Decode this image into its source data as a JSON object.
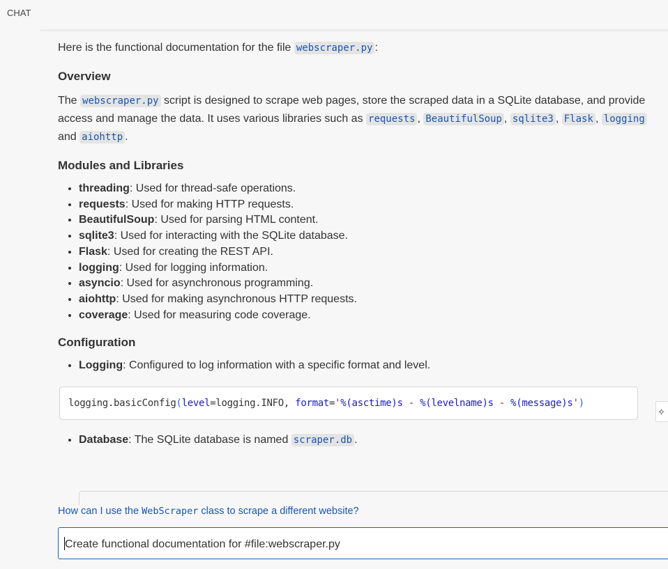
{
  "header": {
    "title": "CHAT"
  },
  "message": {
    "intro": {
      "text": "Here is the functional documentation for the file ",
      "code": "webscraper.py",
      "end": ":"
    },
    "overview": {
      "heading": "Overview",
      "l1a": "The ",
      "l1code": "webscraper.py",
      "l1b": " script is designed to scrape web pages, store the scraped data in a SQLite database, and provide",
      "l2a": "access and manage the data. It uses various libraries such as ",
      "c1": "requests",
      "c2": "BeautifulSoup",
      "c3": "sqlite3",
      "c4": "Flask",
      "c5": "logging",
      "sep": ", ",
      "l3a": "and ",
      "c6": "aiohttp",
      "l3b": "."
    },
    "modules": {
      "heading": "Modules and Libraries",
      "items": [
        {
          "name": "threading",
          "desc": ": Used for thread-safe operations."
        },
        {
          "name": "requests",
          "desc": ": Used for making HTTP requests."
        },
        {
          "name": "BeautifulSoup",
          "desc": ": Used for parsing HTML content."
        },
        {
          "name": "sqlite3",
          "desc": ": Used for interacting with the SQLite database."
        },
        {
          "name": "Flask",
          "desc": ": Used for creating the REST API."
        },
        {
          "name": "logging",
          "desc": ": Used for logging information."
        },
        {
          "name": "asyncio",
          "desc": ": Used for asynchronous programming."
        },
        {
          "name": "aiohttp",
          "desc": ": Used for making asynchronous HTTP requests."
        },
        {
          "name": "coverage",
          "desc": ": Used for measuring code coverage."
        }
      ]
    },
    "configuration": {
      "heading": "Configuration",
      "logging": {
        "name": "Logging",
        "desc": ": Configured to log information with a specific format and level."
      },
      "code": {
        "a": "logging.basicConfig",
        "p1": "(",
        "k1": "level",
        "b": "=logging.INFO, ",
        "k2": "format",
        "eq": "=",
        "s1": "'",
        "f": "%(asctime)s",
        "d1": " - ",
        "g": "%(levelname)s",
        "d2": " - ",
        "h": "%(message)s",
        "s2": "'",
        "p2": ")"
      },
      "database": {
        "name": "Database",
        "desc": ": The SQLite database is named ",
        "code": "scraper.db",
        "end": "."
      }
    }
  },
  "suggestion": {
    "a": "How can I use the ",
    "code": "WebScraper",
    "b": " class to scrape a different website?"
  },
  "input": {
    "value": "Create functional documentation for #file:webscraper.py"
  }
}
